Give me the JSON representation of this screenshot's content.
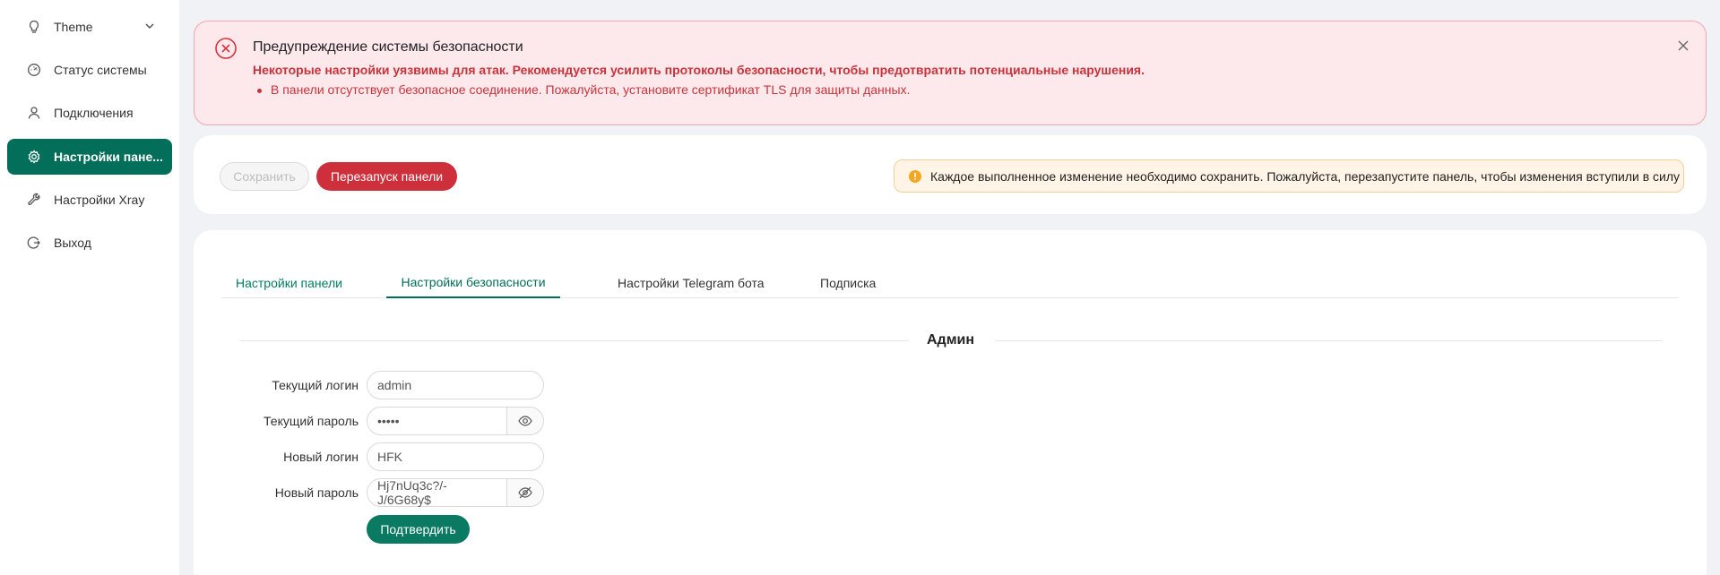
{
  "sidebar": {
    "items": [
      {
        "label": "Theme",
        "icon": "bulb-icon"
      },
      {
        "label": "Статус системы",
        "icon": "dashboard-icon"
      },
      {
        "label": "Подключения",
        "icon": "user-icon"
      },
      {
        "label": "Настройки пане...",
        "icon": "gear-icon"
      },
      {
        "label": "Настройки Xray",
        "icon": "wrench-icon"
      },
      {
        "label": "Выход",
        "icon": "logout-icon"
      }
    ]
  },
  "alert": {
    "title": "Предупреждение системы безопасности",
    "subtitle": "Некоторые настройки уязвимы для атак. Рекомендуется усилить протоколы безопасности, чтобы предотвратить потенциальные нарушения.",
    "items": [
      "В панели отсутствует безопасное соединение. Пожалуйста, установите сертификат TLS для защиты данных."
    ]
  },
  "actions": {
    "save_label": "Сохранить",
    "restart_label": "Перезапуск панели",
    "warning_text": "Каждое выполненное изменение необходимо сохранить. Пожалуйста, перезапустите панель, чтобы изменения вступили в силу"
  },
  "tabs": [
    {
      "label": "Настройки панели"
    },
    {
      "label": "Настройки безопасности"
    },
    {
      "label": "Настройки Telegram бота"
    },
    {
      "label": "Подписка"
    }
  ],
  "admin": {
    "section_title": "Админ",
    "current_login_label": "Текущий логин",
    "current_login_value": "admin",
    "current_password_label": "Текущий пароль",
    "current_password_value": "•••••",
    "new_login_label": "Новый логин",
    "new_login_value": "HFK",
    "new_password_label": "Новый пароль",
    "new_password_value": "Hj7nUq3c?/-J/6G68y$",
    "confirm_label": "Подтвердить"
  },
  "colors": {
    "accent": "#036e5a",
    "danger": "#cd2f3b",
    "alert_bg": "#fde9ec",
    "warning_bg": "#fff4e5"
  }
}
